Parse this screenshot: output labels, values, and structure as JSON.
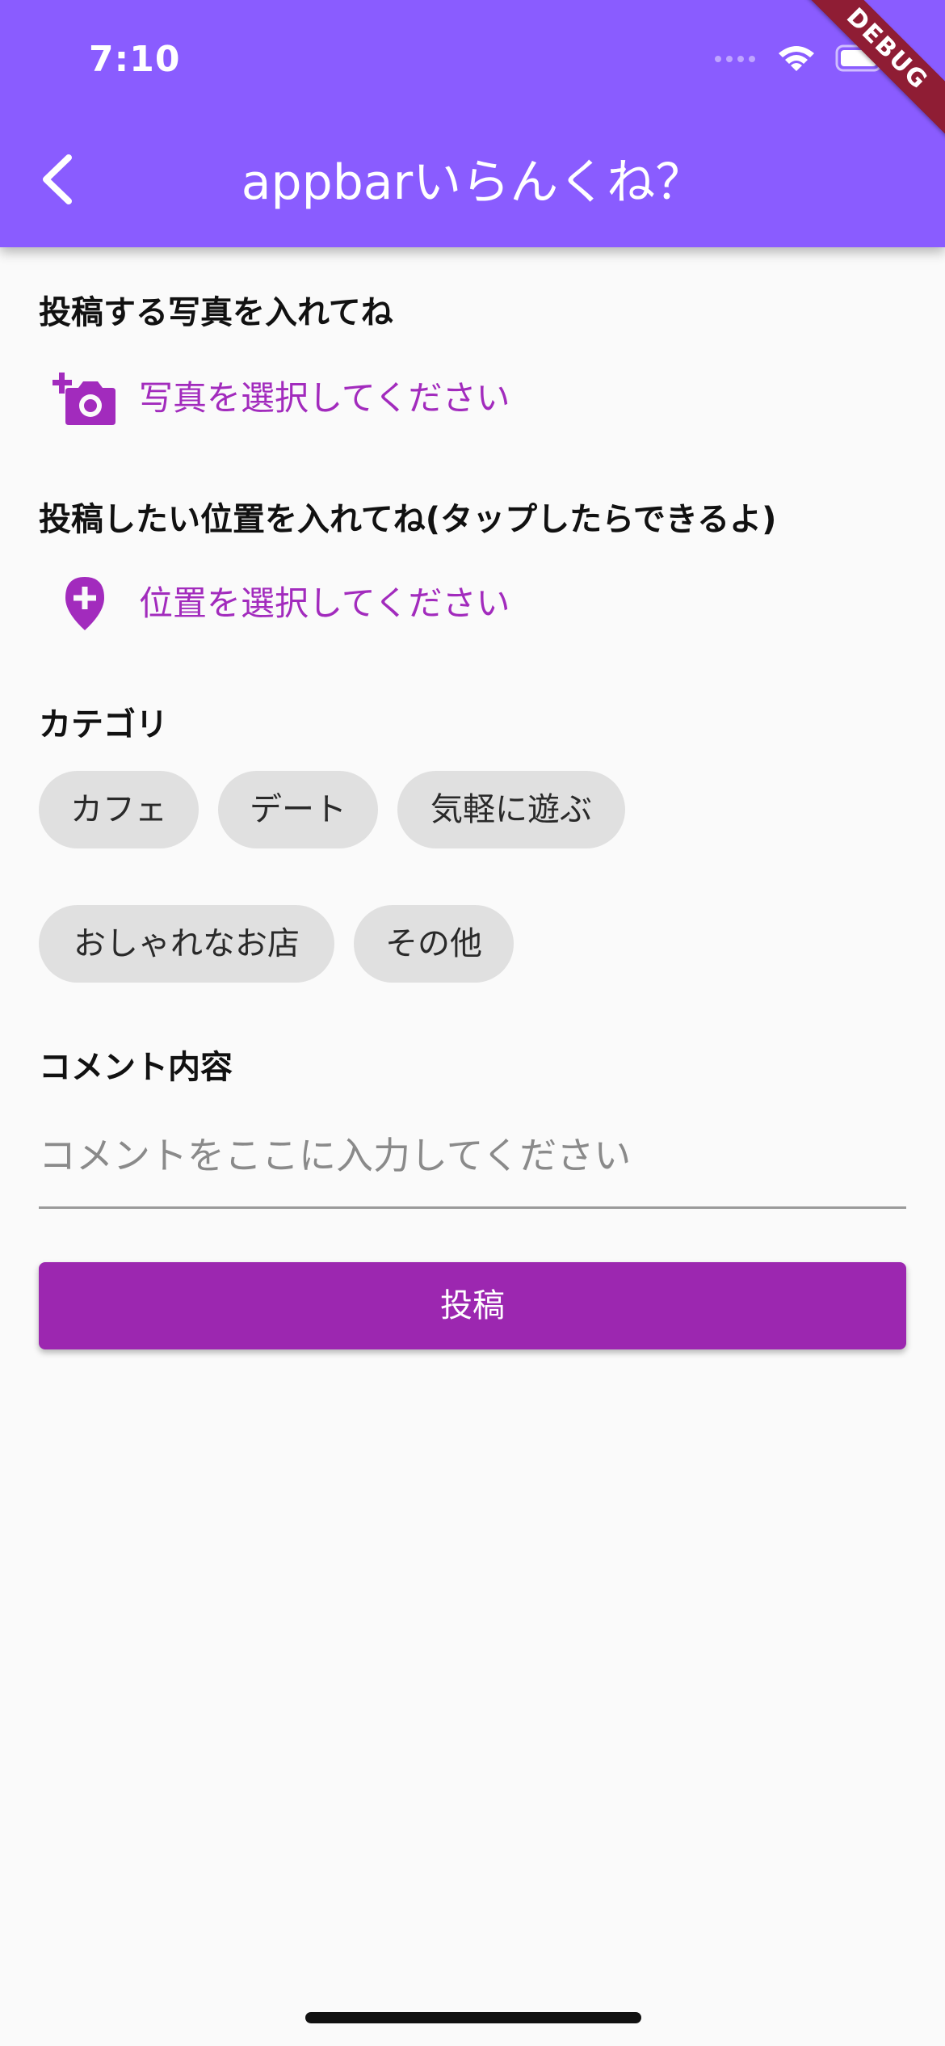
{
  "status_bar": {
    "time": "7:10"
  },
  "debug_banner": "DEBUG",
  "appbar": {
    "title": "appbarいらんくね？",
    "back_icon": "chevron-left-icon"
  },
  "photo_section": {
    "label": "投稿する写真を入れてね",
    "picker_label": "写真を選択してください",
    "icon": "add-a-photo-icon"
  },
  "location_section": {
    "label": "投稿したい位置を入れてね(タップしたらできるよ)",
    "picker_label": "位置を選択してください",
    "icon": "add-location-icon"
  },
  "category_section": {
    "label": "カテゴリ",
    "chips": [
      "カフェ",
      "デート",
      "気軽に遊ぶ",
      "おしゃれなお店",
      "その他"
    ]
  },
  "comment_section": {
    "label": "コメント内容",
    "placeholder": "コメントをここに入力してください",
    "value": ""
  },
  "submit_button": {
    "label": "投稿"
  },
  "colors": {
    "appbar": "#8a5cff",
    "accent": "#9c27b0",
    "picker_text": "#a22bbd",
    "chip_bg": "#e0e0e0",
    "background": "#fafafa"
  }
}
